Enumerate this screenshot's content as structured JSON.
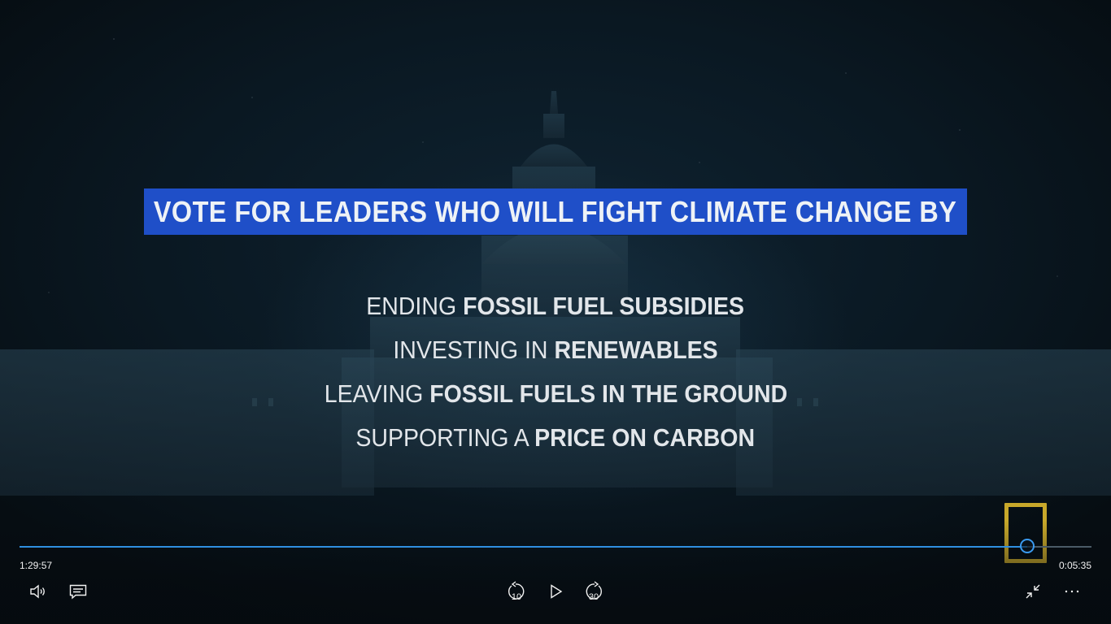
{
  "video": {
    "headline": "VOTE FOR LEADERS WHO WILL FIGHT CLIMATE CHANGE BY",
    "bullets": [
      {
        "lead": "ENDING ",
        "bold": "FOSSIL FUEL SUBSIDIES"
      },
      {
        "lead": "INVESTING IN ",
        "bold": "RENEWABLES"
      },
      {
        "lead": "LEAVING ",
        "bold": "FOSSIL FUELS IN THE GROUND"
      },
      {
        "lead": "SUPPORTING A ",
        "bold": "PRICE ON CARBON"
      }
    ],
    "logo_icon": "national-geographic-logo-icon",
    "headline_bar_color": "#1f4fc8",
    "logo_color": "#c8a82a"
  },
  "player": {
    "elapsed": "1:29:57",
    "remaining": "0:05:35",
    "progress_fraction": 0.94,
    "accent_color": "#2f8fe0",
    "skip_back_label": "10",
    "skip_forward_label": "30",
    "icons": {
      "volume": "volume-icon",
      "captions": "captions-icon",
      "skip_back": "skip-back-10-icon",
      "play": "play-icon",
      "skip_forward": "skip-forward-30-icon",
      "exit_fullscreen": "exit-fullscreen-icon",
      "more": "more-options-icon"
    }
  }
}
